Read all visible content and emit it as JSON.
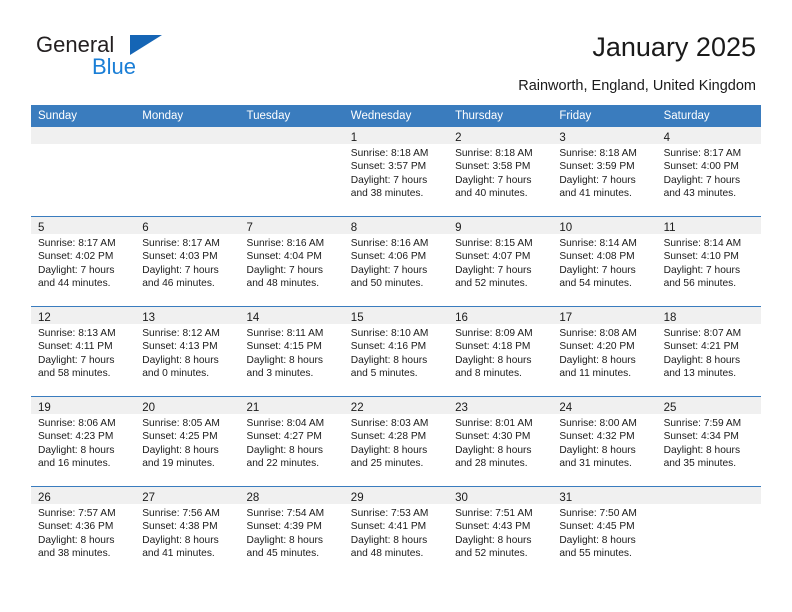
{
  "brand": {
    "name_part1": "General",
    "name_part2": "Blue",
    "triangle_color": "#1565b5",
    "blue_color": "#1a7ed6"
  },
  "header": {
    "title": "January 2025",
    "subtitle": "Rainworth, England, United Kingdom"
  },
  "theme": {
    "header_blue": "#3a7cbe",
    "daynum_band": "#f0f0f0"
  },
  "weekdays": [
    "Sunday",
    "Monday",
    "Tuesday",
    "Wednesday",
    "Thursday",
    "Friday",
    "Saturday"
  ],
  "weeks": [
    [
      {
        "day": "",
        "blank": true,
        "sunrise": "",
        "sunset": "",
        "daylight1": "",
        "daylight2": ""
      },
      {
        "day": "",
        "blank": true,
        "sunrise": "",
        "sunset": "",
        "daylight1": "",
        "daylight2": ""
      },
      {
        "day": "",
        "blank": true,
        "sunrise": "",
        "sunset": "",
        "daylight1": "",
        "daylight2": ""
      },
      {
        "day": "1",
        "sunrise": "Sunrise: 8:18 AM",
        "sunset": "Sunset: 3:57 PM",
        "daylight1": "Daylight: 7 hours",
        "daylight2": "and 38 minutes."
      },
      {
        "day": "2",
        "sunrise": "Sunrise: 8:18 AM",
        "sunset": "Sunset: 3:58 PM",
        "daylight1": "Daylight: 7 hours",
        "daylight2": "and 40 minutes."
      },
      {
        "day": "3",
        "sunrise": "Sunrise: 8:18 AM",
        "sunset": "Sunset: 3:59 PM",
        "daylight1": "Daylight: 7 hours",
        "daylight2": "and 41 minutes."
      },
      {
        "day": "4",
        "sunrise": "Sunrise: 8:17 AM",
        "sunset": "Sunset: 4:00 PM",
        "daylight1": "Daylight: 7 hours",
        "daylight2": "and 43 minutes."
      }
    ],
    [
      {
        "day": "5",
        "sunrise": "Sunrise: 8:17 AM",
        "sunset": "Sunset: 4:02 PM",
        "daylight1": "Daylight: 7 hours",
        "daylight2": "and 44 minutes."
      },
      {
        "day": "6",
        "sunrise": "Sunrise: 8:17 AM",
        "sunset": "Sunset: 4:03 PM",
        "daylight1": "Daylight: 7 hours",
        "daylight2": "and 46 minutes."
      },
      {
        "day": "7",
        "sunrise": "Sunrise: 8:16 AM",
        "sunset": "Sunset: 4:04 PM",
        "daylight1": "Daylight: 7 hours",
        "daylight2": "and 48 minutes."
      },
      {
        "day": "8",
        "sunrise": "Sunrise: 8:16 AM",
        "sunset": "Sunset: 4:06 PM",
        "daylight1": "Daylight: 7 hours",
        "daylight2": "and 50 minutes."
      },
      {
        "day": "9",
        "sunrise": "Sunrise: 8:15 AM",
        "sunset": "Sunset: 4:07 PM",
        "daylight1": "Daylight: 7 hours",
        "daylight2": "and 52 minutes."
      },
      {
        "day": "10",
        "sunrise": "Sunrise: 8:14 AM",
        "sunset": "Sunset: 4:08 PM",
        "daylight1": "Daylight: 7 hours",
        "daylight2": "and 54 minutes."
      },
      {
        "day": "11",
        "sunrise": "Sunrise: 8:14 AM",
        "sunset": "Sunset: 4:10 PM",
        "daylight1": "Daylight: 7 hours",
        "daylight2": "and 56 minutes."
      }
    ],
    [
      {
        "day": "12",
        "sunrise": "Sunrise: 8:13 AM",
        "sunset": "Sunset: 4:11 PM",
        "daylight1": "Daylight: 7 hours",
        "daylight2": "and 58 minutes."
      },
      {
        "day": "13",
        "sunrise": "Sunrise: 8:12 AM",
        "sunset": "Sunset: 4:13 PM",
        "daylight1": "Daylight: 8 hours",
        "daylight2": "and 0 minutes."
      },
      {
        "day": "14",
        "sunrise": "Sunrise: 8:11 AM",
        "sunset": "Sunset: 4:15 PM",
        "daylight1": "Daylight: 8 hours",
        "daylight2": "and 3 minutes."
      },
      {
        "day": "15",
        "sunrise": "Sunrise: 8:10 AM",
        "sunset": "Sunset: 4:16 PM",
        "daylight1": "Daylight: 8 hours",
        "daylight2": "and 5 minutes."
      },
      {
        "day": "16",
        "sunrise": "Sunrise: 8:09 AM",
        "sunset": "Sunset: 4:18 PM",
        "daylight1": "Daylight: 8 hours",
        "daylight2": "and 8 minutes."
      },
      {
        "day": "17",
        "sunrise": "Sunrise: 8:08 AM",
        "sunset": "Sunset: 4:20 PM",
        "daylight1": "Daylight: 8 hours",
        "daylight2": "and 11 minutes."
      },
      {
        "day": "18",
        "sunrise": "Sunrise: 8:07 AM",
        "sunset": "Sunset: 4:21 PM",
        "daylight1": "Daylight: 8 hours",
        "daylight2": "and 13 minutes."
      }
    ],
    [
      {
        "day": "19",
        "sunrise": "Sunrise: 8:06 AM",
        "sunset": "Sunset: 4:23 PM",
        "daylight1": "Daylight: 8 hours",
        "daylight2": "and 16 minutes."
      },
      {
        "day": "20",
        "sunrise": "Sunrise: 8:05 AM",
        "sunset": "Sunset: 4:25 PM",
        "daylight1": "Daylight: 8 hours",
        "daylight2": "and 19 minutes."
      },
      {
        "day": "21",
        "sunrise": "Sunrise: 8:04 AM",
        "sunset": "Sunset: 4:27 PM",
        "daylight1": "Daylight: 8 hours",
        "daylight2": "and 22 minutes."
      },
      {
        "day": "22",
        "sunrise": "Sunrise: 8:03 AM",
        "sunset": "Sunset: 4:28 PM",
        "daylight1": "Daylight: 8 hours",
        "daylight2": "and 25 minutes."
      },
      {
        "day": "23",
        "sunrise": "Sunrise: 8:01 AM",
        "sunset": "Sunset: 4:30 PM",
        "daylight1": "Daylight: 8 hours",
        "daylight2": "and 28 minutes."
      },
      {
        "day": "24",
        "sunrise": "Sunrise: 8:00 AM",
        "sunset": "Sunset: 4:32 PM",
        "daylight1": "Daylight: 8 hours",
        "daylight2": "and 31 minutes."
      },
      {
        "day": "25",
        "sunrise": "Sunrise: 7:59 AM",
        "sunset": "Sunset: 4:34 PM",
        "daylight1": "Daylight: 8 hours",
        "daylight2": "and 35 minutes."
      }
    ],
    [
      {
        "day": "26",
        "sunrise": "Sunrise: 7:57 AM",
        "sunset": "Sunset: 4:36 PM",
        "daylight1": "Daylight: 8 hours",
        "daylight2": "and 38 minutes."
      },
      {
        "day": "27",
        "sunrise": "Sunrise: 7:56 AM",
        "sunset": "Sunset: 4:38 PM",
        "daylight1": "Daylight: 8 hours",
        "daylight2": "and 41 minutes."
      },
      {
        "day": "28",
        "sunrise": "Sunrise: 7:54 AM",
        "sunset": "Sunset: 4:39 PM",
        "daylight1": "Daylight: 8 hours",
        "daylight2": "and 45 minutes."
      },
      {
        "day": "29",
        "sunrise": "Sunrise: 7:53 AM",
        "sunset": "Sunset: 4:41 PM",
        "daylight1": "Daylight: 8 hours",
        "daylight2": "and 48 minutes."
      },
      {
        "day": "30",
        "sunrise": "Sunrise: 7:51 AM",
        "sunset": "Sunset: 4:43 PM",
        "daylight1": "Daylight: 8 hours",
        "daylight2": "and 52 minutes."
      },
      {
        "day": "31",
        "sunrise": "Sunrise: 7:50 AM",
        "sunset": "Sunset: 4:45 PM",
        "daylight1": "Daylight: 8 hours",
        "daylight2": "and 55 minutes."
      },
      {
        "day": "",
        "blank": true,
        "sunrise": "",
        "sunset": "",
        "daylight1": "",
        "daylight2": ""
      }
    ]
  ]
}
